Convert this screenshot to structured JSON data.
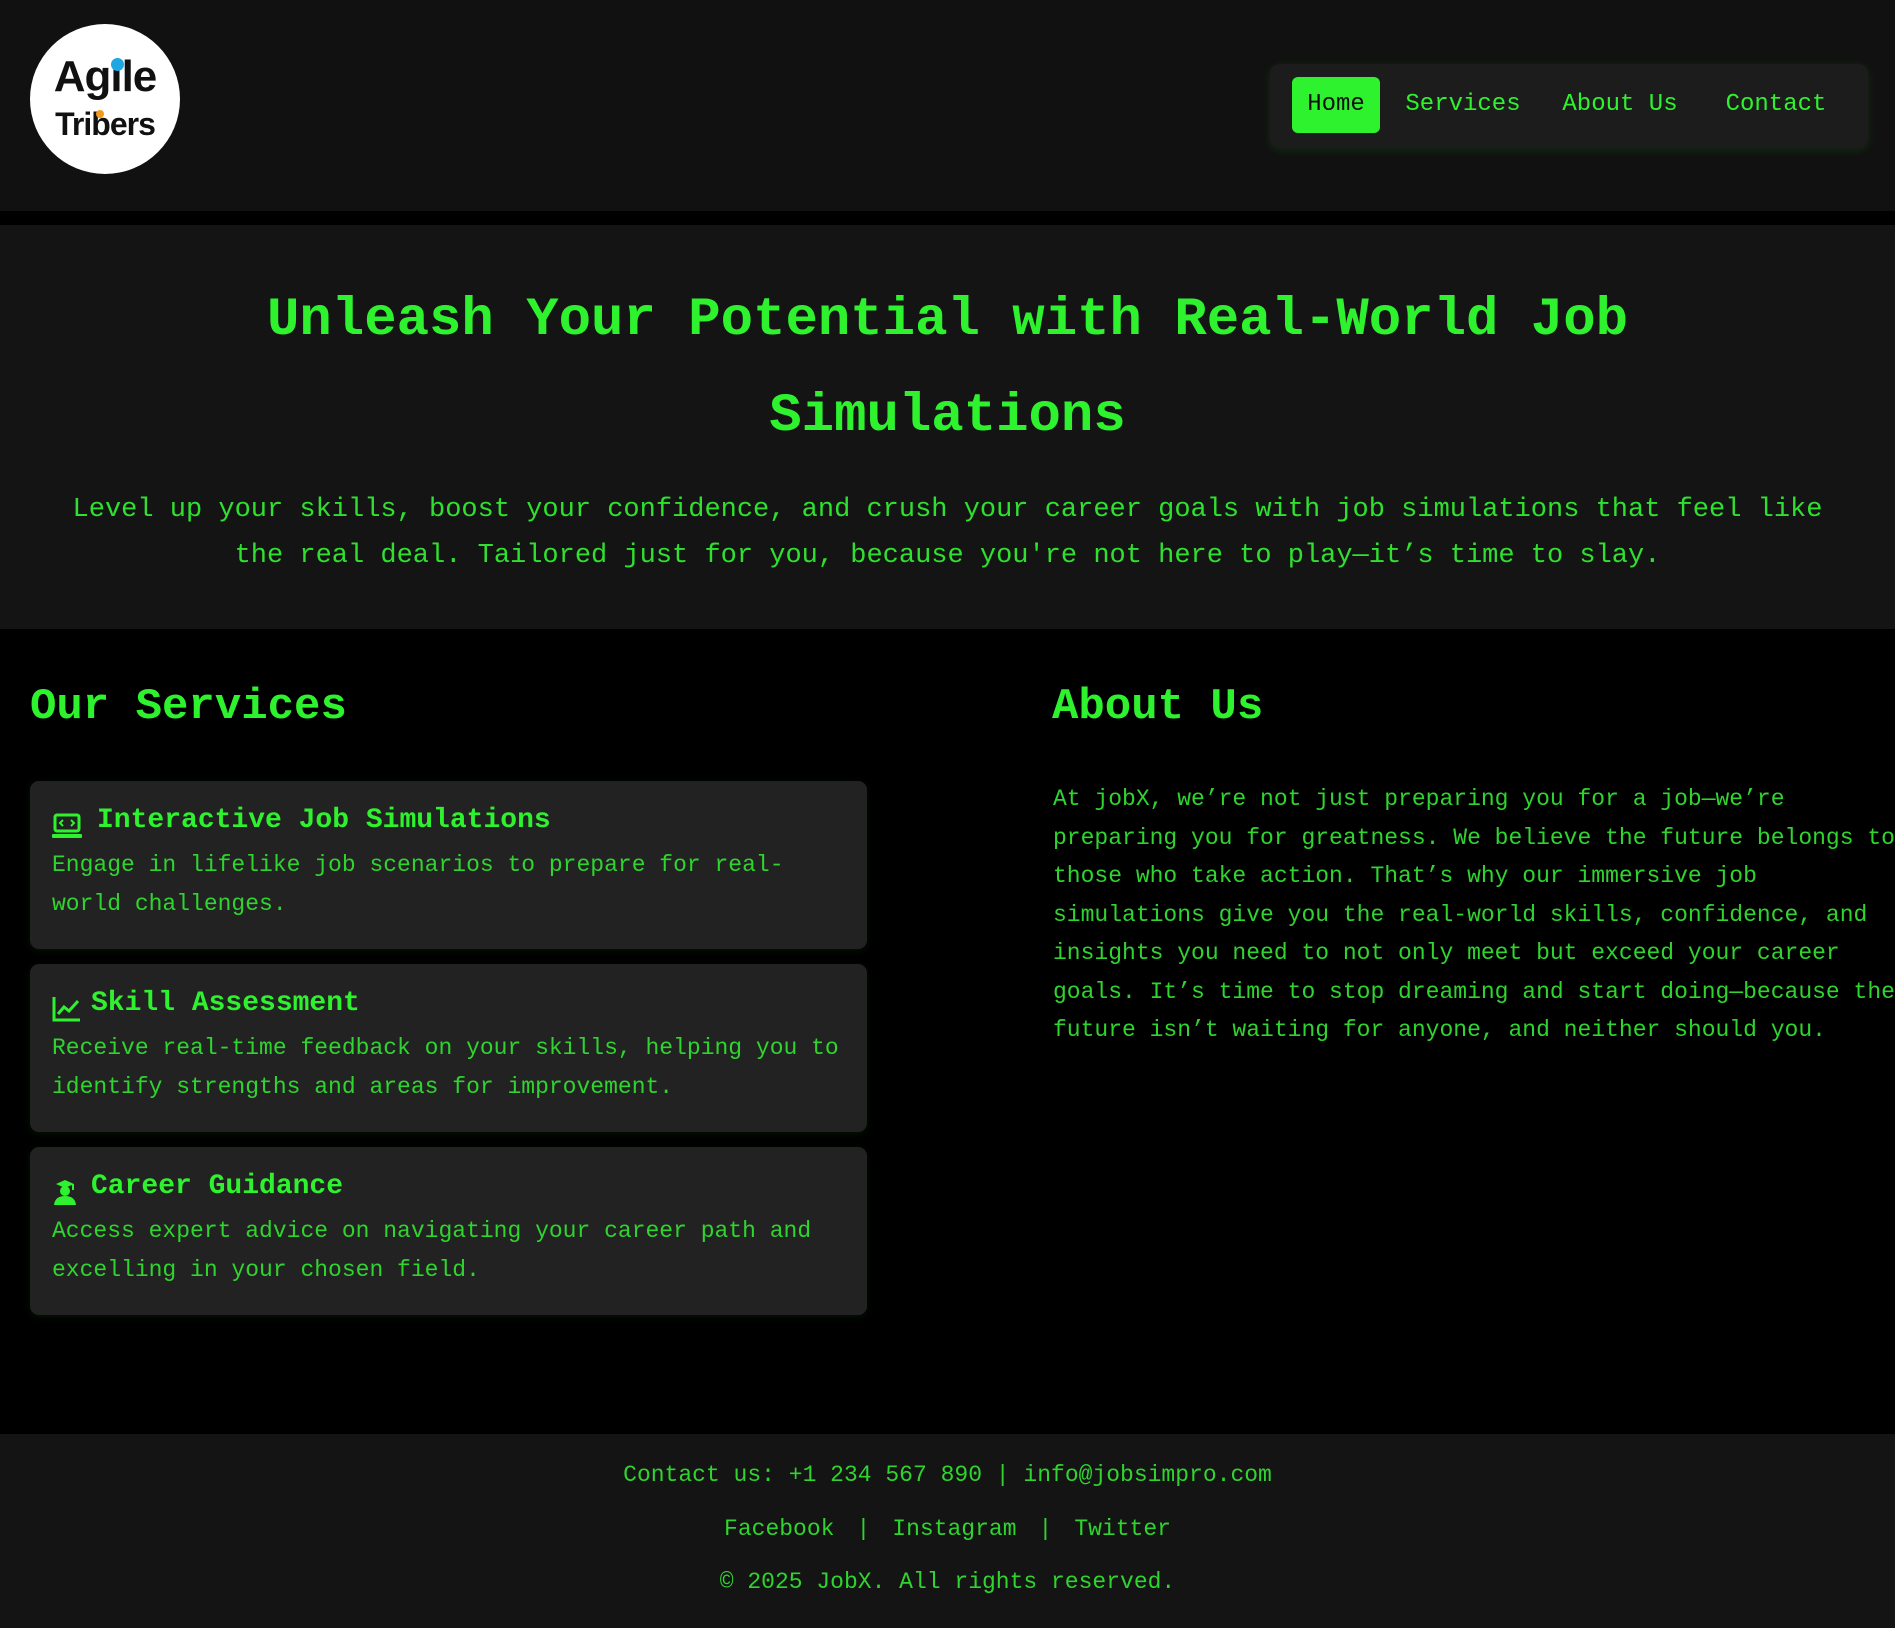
{
  "logo": {
    "line1": "Agile",
    "line2": "Tribers",
    "colors": {
      "dot_blue": "#1ea7e0",
      "dot_orange": "#f29a1b"
    }
  },
  "nav": {
    "items": [
      {
        "label": "Home",
        "active": true
      },
      {
        "label": "Services",
        "active": false
      },
      {
        "label": "About Us",
        "active": false
      },
      {
        "label": "Contact",
        "active": false
      }
    ]
  },
  "hero": {
    "title": "Unleash Your Potential with Real-World Job Simulations",
    "subtitle_line1": "Level up your skills, boost your confidence, and crush your career goals with job simulations that feel like",
    "subtitle_line2": "the real deal. Tailored just for you, because you're not here to play—it’s time to slay."
  },
  "services": {
    "heading": "Our Services",
    "cards": [
      {
        "icon": "laptop-code-icon",
        "title": "Interactive Job Simulations",
        "text": "Engage in lifelike job scenarios to prepare for real-world challenges."
      },
      {
        "icon": "chart-line-icon",
        "title": "Skill Assessment",
        "text": "Receive real-time feedback on your skills, helping you to identify strengths and areas for improvement."
      },
      {
        "icon": "graduate-icon",
        "title": "Career Guidance",
        "text": "Access expert advice on navigating your career path and excelling in your chosen field."
      }
    ]
  },
  "about": {
    "heading": "About Us",
    "text": "At jobX, we’re not just preparing you for a job—we’re preparing you for greatness. We believe the future belongs to those who take action. That’s why our immersive job simulations give you the real-world skills, confidence, and insights you need to not only meet but exceed your career goals. It’s time to stop dreaming and start doing—because the future isn’t waiting for anyone, and neither should you."
  },
  "footer": {
    "contact": "Contact us: +1 234 567 890 | info@jobsimpro.com",
    "social": [
      "Facebook",
      "Instagram",
      "Twitter"
    ],
    "separator": "|",
    "copyright": "© 2025 JobX. All rights reserved."
  },
  "colors": {
    "accent": "#2ff22f",
    "background": "#000000",
    "header_bg": "#111111",
    "card_bg": "#222222"
  }
}
